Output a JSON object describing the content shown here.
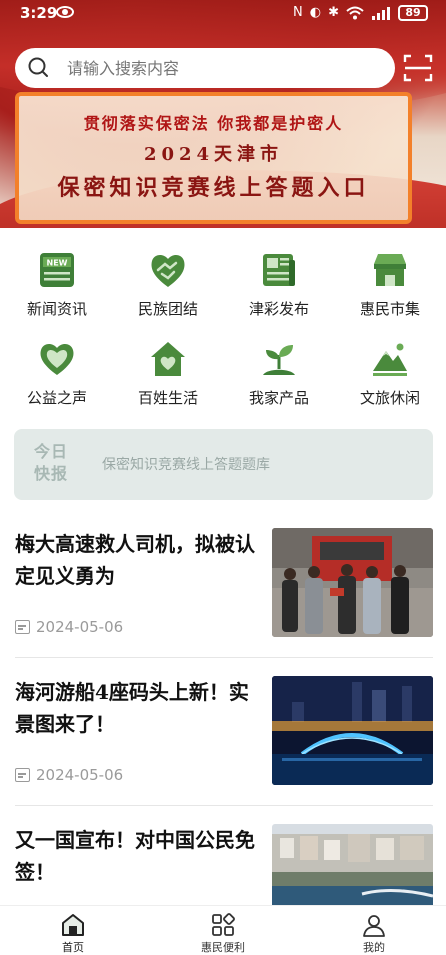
{
  "status_bar": {
    "time": "3:29",
    "battery": "89",
    "icons": [
      "nfc-icon",
      "mute-icon",
      "bluetooth-icon",
      "wifi-icon",
      "signal-icon"
    ]
  },
  "search": {
    "placeholder": "请输入搜索内容",
    "icon": "search-icon",
    "scan_icon": "scan-icon"
  },
  "banner": {
    "line1": "贯彻落实保密法  你我都是护密人",
    "line2": "2024天津市",
    "line3": "保密知识竞赛线上答题入口",
    "border_color": "#f3802a",
    "text_color": "#8a1512"
  },
  "categories": [
    {
      "label": "新闻资讯",
      "icon": "news-icon"
    },
    {
      "label": "民族团结",
      "icon": "handshake-icon"
    },
    {
      "label": "津彩发布",
      "icon": "newspaper-icon"
    },
    {
      "label": "惠民市集",
      "icon": "shop-icon"
    },
    {
      "label": "公益之声",
      "icon": "heart-icon"
    },
    {
      "label": "百姓生活",
      "icon": "house-heart-icon"
    },
    {
      "label": "我家产品",
      "icon": "sprout-icon"
    },
    {
      "label": "文旅休闲",
      "icon": "mountain-icon"
    }
  ],
  "category_icon_color": "#4a8a3c",
  "quick_news": {
    "tag": "今日快报",
    "text": "保密知识竞赛线上答题题库"
  },
  "news": [
    {
      "title": "梅大高速救人司机，拟被认定见义勇为",
      "date": "2024-05-06",
      "thumb": "photo-people-fire-truck"
    },
    {
      "title": "海河游船4座码头上新！实景图来了！",
      "date": "2024-05-06",
      "thumb": "photo-night-river-city"
    },
    {
      "title": "又一国宣布！对中国公民免签！",
      "date": "",
      "thumb": "photo-coastal-city"
    }
  ],
  "bottom_nav": [
    {
      "label": "首页",
      "icon": "home-icon",
      "active": true
    },
    {
      "label": "惠民便利",
      "icon": "grid-icon",
      "active": false
    },
    {
      "label": "我的",
      "icon": "user-icon",
      "active": false
    }
  ]
}
